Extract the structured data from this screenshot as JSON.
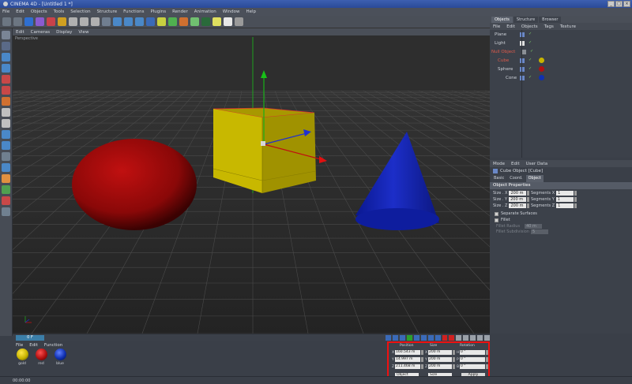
{
  "window": {
    "title": "CINEMA 4D - [Untitled 1 *]"
  },
  "menubar": [
    "File",
    "Edit",
    "Objects",
    "Tools",
    "Selection",
    "Structure",
    "Functions",
    "Plugins",
    "Render",
    "Animation",
    "Window",
    "Help"
  ],
  "viewport": {
    "menu": [
      "Edit",
      "Cameras",
      "Display",
      "View"
    ],
    "label": "Perspective"
  },
  "objects_panel": {
    "tabs": [
      "Objects",
      "Structure",
      "Browser"
    ],
    "menu": [
      "File",
      "Edit",
      "Objects",
      "Tags",
      "Texture"
    ],
    "items": [
      {
        "name": "Plane",
        "color": "#cfd3da"
      },
      {
        "name": "Light",
        "color": "#cfd3da"
      },
      {
        "name": "Null Object",
        "color": "#e05a4a"
      },
      {
        "name": "Cube",
        "color": "#e05a4a"
      },
      {
        "name": "Sphere",
        "color": "#cfd3da"
      },
      {
        "name": "Cone",
        "color": "#cfd3da"
      }
    ]
  },
  "attributes_panel": {
    "menu": [
      "Mode",
      "Edit",
      "User Data"
    ],
    "title": "Cube Object [Cube]",
    "tabs": [
      "Basic",
      "Coord.",
      "Object"
    ],
    "section": "Object Properties",
    "size_labels": [
      "Size . X",
      "Size . Y",
      "Size . Z"
    ],
    "size_values": [
      "200 m",
      "200 m",
      "200 m"
    ],
    "segment_labels": [
      "Segments X",
      "Segments Y",
      "Segments Z"
    ],
    "segment_values": [
      "1",
      "1",
      "1"
    ],
    "separate_surfaces": "Separate Surfaces",
    "fillet": "Fillet",
    "fillet_radius_label": "Fillet Radius",
    "fillet_radius_value": "40 m",
    "fillet_subdivision_label": "Fillet Subdivision",
    "fillet_subdivision_value": "5"
  },
  "timeline": {
    "frame": "0 F"
  },
  "material_manager": {
    "menu": [
      "File",
      "Edit",
      "Function"
    ],
    "materials": [
      {
        "name": "gold",
        "color": "#c8b400"
      },
      {
        "name": "red",
        "color": "#b01010"
      },
      {
        "name": "blue",
        "color": "#1030b0"
      }
    ]
  },
  "coordinates": {
    "headers": {
      "position": "Position",
      "size": "Size",
      "rotation": "Rotation"
    },
    "position_axes": [
      "X",
      "Y",
      "Z"
    ],
    "position": [
      "160.543 m",
      "14.997 m",
      "211.468 m"
    ],
    "size_axes": [
      "X",
      "Y",
      "Z"
    ],
    "size": [
      "200 m",
      "200 m",
      "200 m"
    ],
    "rotation_axes": [
      "H",
      "P",
      "B"
    ],
    "rotation": [
      "0 °",
      "0 °",
      "0 °"
    ],
    "mode_object": "Object",
    "mode_size": "Size",
    "apply": "Apply"
  },
  "statusbar": {
    "time": "00:00:00"
  },
  "colors": {
    "accent_highlight": "#e11111",
    "viewport_bg": "#2c2c2c",
    "panel_bg": "#3c414a",
    "cube": "#c8b800",
    "sphere": "#b00a0a",
    "cone": "#1020b0"
  }
}
